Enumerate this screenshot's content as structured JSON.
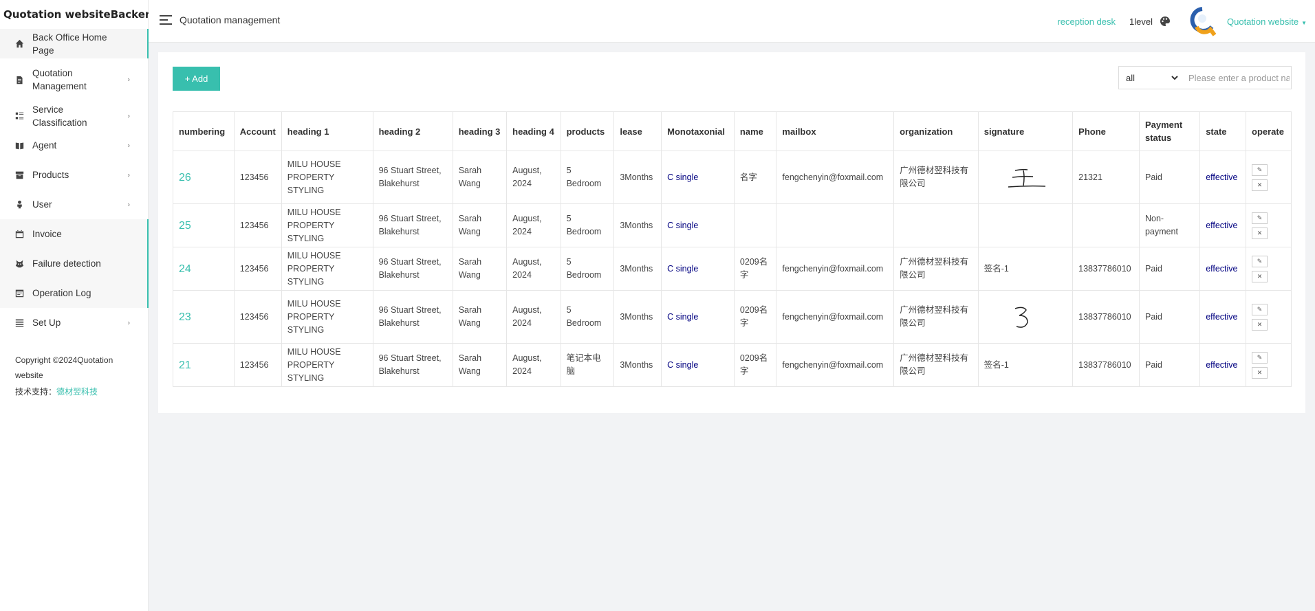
{
  "brand": "Quotation websiteBackend",
  "sidebar": {
    "items": [
      {
        "label": "Back Office Home Page",
        "icon": "home-icon"
      },
      {
        "label": "Quotation Management",
        "icon": "document-icon"
      },
      {
        "label": "Service Classification",
        "icon": "grid-icon"
      },
      {
        "label": "Agent",
        "icon": "book-icon"
      },
      {
        "label": "Products",
        "icon": "archive-icon"
      },
      {
        "label": "User",
        "icon": "user-icon"
      },
      {
        "label": "Invoice",
        "icon": "calendar-icon"
      },
      {
        "label": "Failure detection",
        "icon": "bug-icon"
      },
      {
        "label": "Operation Log",
        "icon": "log-icon"
      },
      {
        "label": "Set Up",
        "icon": "list-icon"
      }
    ],
    "copyright": "Copyright ©2024Quotation website",
    "support_label": "技术支持：",
    "support_link": "德材翌科技"
  },
  "header": {
    "title": "Quotation management",
    "reception": "reception desk",
    "level": "1level",
    "user": "Quotation website"
  },
  "toolbar": {
    "add_label": "+ Add",
    "filter_selected": "all",
    "search_placeholder": "Please enter a product name"
  },
  "table": {
    "columns": [
      "numbering",
      "Account",
      "heading 1",
      "heading 2",
      "heading 3",
      "heading 4",
      "products",
      "lease",
      "Monotaxonial",
      "name",
      "mailbox",
      "organization",
      "signature",
      "Phone",
      "Payment status",
      "state",
      "operate"
    ],
    "rows": [
      {
        "numbering": "26",
        "account": "123456",
        "heading1": "MILU HOUSE PROPERTY STYLING",
        "heading2": "96 Stuart Street, Blakehurst",
        "heading3": "Sarah Wang",
        "heading4": "August, 2024",
        "products": "5 Bedroom",
        "lease": "3Months",
        "mono": "C single",
        "name": "名字",
        "mailbox": "fengchenyin@foxmail.com",
        "organization": "广州德材翌科技有限公司",
        "signature": "",
        "signature_image": "handwritten-wang",
        "phone": "21321",
        "payment": "Paid",
        "state": "effective"
      },
      {
        "numbering": "25",
        "account": "123456",
        "heading1": "MILU HOUSE PROPERTY STYLING",
        "heading2": "96 Stuart Street, Blakehurst",
        "heading3": "Sarah Wang",
        "heading4": "August, 2024",
        "products": "5 Bedroom",
        "lease": "3Months",
        "mono": "C single",
        "name": "",
        "mailbox": "",
        "organization": "",
        "signature": "",
        "signature_image": "",
        "phone": "",
        "payment": "Non-payment",
        "state": "effective"
      },
      {
        "numbering": "24",
        "account": "123456",
        "heading1": "MILU HOUSE PROPERTY STYLING",
        "heading2": "96 Stuart Street, Blakehurst",
        "heading3": "Sarah Wang",
        "heading4": "August, 2024",
        "products": "5 Bedroom",
        "lease": "3Months",
        "mono": "C single",
        "name": "0209名字",
        "mailbox": "fengchenyin@foxmail.com",
        "organization": "广州德材翌科技有限公司",
        "signature": "签名-1",
        "signature_image": "",
        "phone": "13837786010",
        "payment": "Paid",
        "state": "effective"
      },
      {
        "numbering": "23",
        "account": "123456",
        "heading1": "MILU HOUSE PROPERTY STYLING",
        "heading2": "96 Stuart Street, Blakehurst",
        "heading3": "Sarah Wang",
        "heading4": "August, 2024",
        "products": "5 Bedroom",
        "lease": "3Months",
        "mono": "C single",
        "name": "0209名字",
        "mailbox": "fengchenyin@foxmail.com",
        "organization": "广州德材翌科技有限公司",
        "signature": "",
        "signature_image": "handwritten-3",
        "phone": "13837786010",
        "payment": "Paid",
        "state": "effective"
      },
      {
        "numbering": "21",
        "account": "123456",
        "heading1": "MILU HOUSE PROPERTY STYLING",
        "heading2": "96 Stuart Street, Blakehurst",
        "heading3": "Sarah Wang",
        "heading4": "August, 2024",
        "products": "笔记本电脑",
        "lease": "3Months",
        "mono": "C single",
        "name": "0209名字",
        "mailbox": "fengchenyin@foxmail.com",
        "organization": "广州德材翌科技有限公司",
        "signature": "签名-1",
        "signature_image": "",
        "phone": "13837786010",
        "payment": "Paid",
        "state": "effective"
      }
    ]
  },
  "colors": {
    "accent": "#38bfae",
    "state": "#000080",
    "background": "#f2f3f5"
  }
}
